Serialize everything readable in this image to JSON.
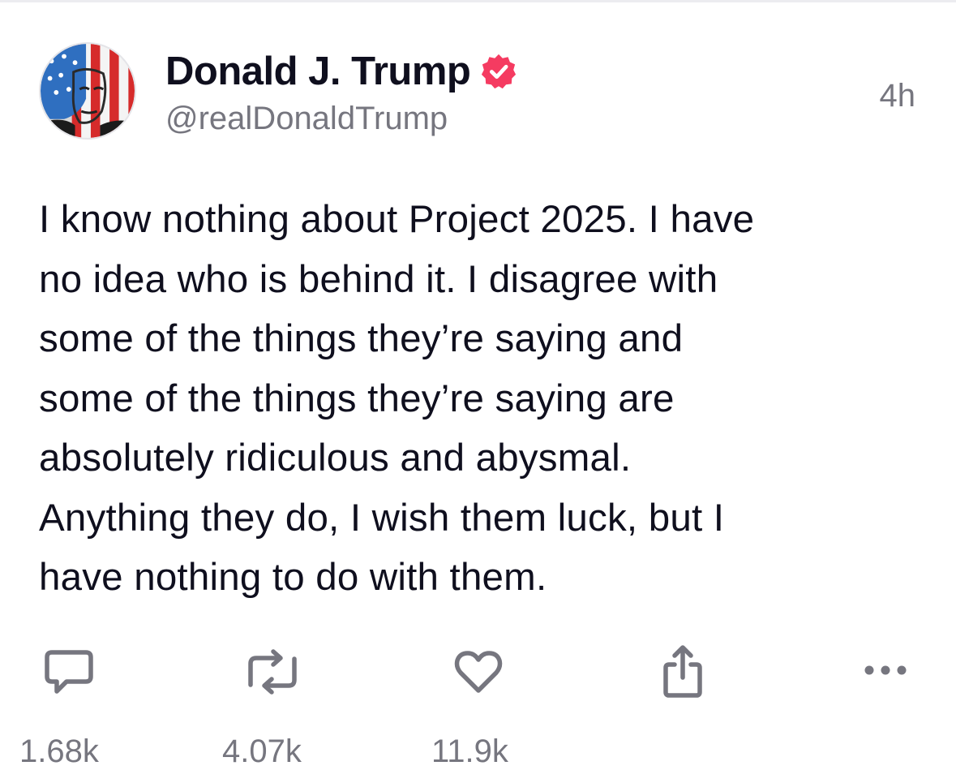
{
  "post": {
    "display_name": "Donald J. Trump",
    "handle": "@realDonaldTrump",
    "timestamp": "4h",
    "lines": [
      "I know nothing about Project 2025. I have",
      "no idea who is behind it. I disagree with",
      "some of the things they’re saying and",
      "some of the things they’re saying are",
      "absolutely ridiculous and abysmal.",
      "Anything they do, I wish them luck, but I",
      "have nothing to do with them."
    ]
  },
  "actions": {
    "reply_count": "1.68k",
    "repost_count": "4.07k",
    "like_count": "11.9k"
  },
  "icons": {
    "reply": "reply-icon",
    "repost": "repost-icon",
    "like": "heart-icon",
    "share": "share-icon",
    "more": "more-icon",
    "verified": "verified-badge-icon"
  },
  "colors": {
    "verified_badge": "#f53b61",
    "icon_gray": "#76767f",
    "text": "#0f0f1e"
  }
}
